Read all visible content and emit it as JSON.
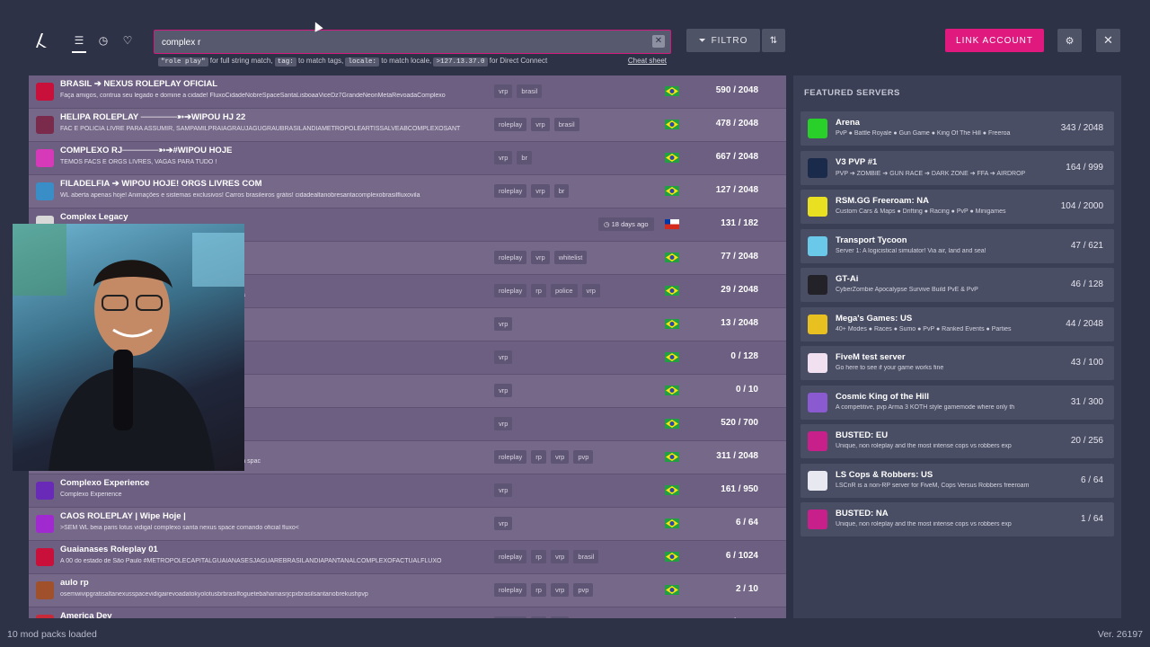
{
  "nav": {
    "logo_icon": "fivem-logo-icon",
    "icons": [
      "list-icon",
      "history-icon",
      "heart-icon"
    ]
  },
  "search": {
    "value": "complex r",
    "hints": {
      "code1": "\"role play\"",
      "text1": " for full string match, ",
      "code2": "tag:",
      "text2": " to match tags, ",
      "code3": "locale:",
      "text3": " to match locale, ",
      "code4": ">127.13.37.0",
      "text4": " for Direct Connect",
      "cheat": "Cheat sheet"
    }
  },
  "toolbar": {
    "filter_label": "FILTRO",
    "link_label": "LINK ACCOUNT"
  },
  "colors": {
    "accent": "#e0197f",
    "list_bg": "#6c5f81",
    "panel_bg": "#3b3f55"
  },
  "servers": [
    {
      "name": "BRASIL ➔ NEXUS ROLEPLAY OFICIAL",
      "desc": "Faça amigos, contrua seu legado e domine a cidade! FluxoCidadeNobreSpaceSantaLisboaaViceDz7GrandeNeonMetaRevoadaComplexo",
      "tags": [
        "vrp",
        "brasil"
      ],
      "updated": "",
      "flag": "brazil",
      "players": "590 / 2048",
      "icon_color": "#c8103a"
    },
    {
      "name": "HELIPA ROLEPLAY ──────➳➔WIPOU HJ 22",
      "desc": "FAC E POLICIA LIVRE PARA ASSUMIR, SAMPAMILPRAIAGRAUJAGUGRAUBRASILANDIAMETROPOLEARTISSALVEABCOMPLEXOSANT",
      "tags": [
        "roleplay",
        "vrp",
        "brasil"
      ],
      "updated": "",
      "flag": "brazil",
      "players": "478 / 2048",
      "icon_color": "#7a2a4a"
    },
    {
      "name": "COMPLEXO RJ──────➳➔#WIPOU HOJE",
      "desc": "TEMOS FACS E ORGS LIVRES, VAGAS PARA TUDO !",
      "tags": [
        "vrp",
        "br"
      ],
      "updated": "",
      "flag": "brazil",
      "players": "667 / 2048",
      "icon_color": "#d63ab8"
    },
    {
      "name": "FILADELFIA ➔ WIPOU HOJE! ORGS LIVRES COM",
      "desc": "WL aberta apenas hoje! Animações e sistemas exclusivos! Carros brasileiros grátis! cidadealtanobresantacomplexobrasilfluxovila",
      "tags": [
        "roleplay",
        "vrp",
        "br"
      ],
      "updated": "",
      "flag": "brazil",
      "players": "127 / 2048",
      "icon_color": "#3a8ec8"
    },
    {
      "name": "Complex Legacy",
      "desc": "",
      "tags": [],
      "updated": "18 days ago",
      "flag": "chile",
      "players": "131 / 182",
      "icon_color": "#d8d8d8"
    },
    {
      "name": "",
      "desc": "celisboadz7brasilneoncomplexocpxmetaeuforiagoatkeerp",
      "tags": [
        "roleplay",
        "vrp",
        "whitelist"
      ],
      "updated": "",
      "flag": "brazil",
      "players": "77 / 2048",
      "icon_color": "#8a6aa0"
    },
    {
      "name": "",
      "desc": "zeszonanortezonalestecomplexobrasilcapitalfluxometropolesampa",
      "tags": [
        "roleplay",
        "rp",
        "police",
        "vrp"
      ],
      "updated": "",
      "flag": "brazil",
      "players": "29 / 2048",
      "icon_color": "#8a6aa0"
    },
    {
      "name": "",
      "desc": "COMPLEXOMETROPOLEALTACIDADEBRASILANDIA",
      "tags": [
        "vrp"
      ],
      "updated": "",
      "flag": "brazil",
      "players": "13 / 2048",
      "icon_color": "#8a6aa0"
    },
    {
      "name": "────",
      "desc": "pace comando oficial fluxo<",
      "tags": [
        "vrp"
      ],
      "updated": "",
      "flag": "brazil",
      "players": "0 / 128",
      "icon_color": "#8a6aa0"
    },
    {
      "name": "────",
      "desc": "pace comando oficial fluxo<",
      "tags": [
        "vrp"
      ],
      "updated": "",
      "flag": "brazil",
      "players": "0 / 10",
      "icon_color": "#8a6aa0"
    },
    {
      "name": "",
      "desc": "",
      "tags": [
        "vrp"
      ],
      "updated": "",
      "flag": "brazil",
      "players": "520 / 700",
      "icon_color": "#8a6aa0"
    },
    {
      "name": "",
      "desc": "hush season rp roleplay city europacity inaugurou Hoje cidade alta spac",
      "tags": [
        "roleplay",
        "rp",
        "vrp",
        "pvp"
      ],
      "updated": "",
      "flag": "brazil",
      "players": "311 / 2048",
      "icon_color": "#8a6aa0"
    },
    {
      "name": "Complexo Experience",
      "desc": "Complexo Experience",
      "tags": [
        "vrp"
      ],
      "updated": "",
      "flag": "brazil",
      "players": "161 / 950",
      "icon_color": "#6a2ab8"
    },
    {
      "name": "CAOS ROLEPLAY | Wipe Hoje |",
      "desc": ">SEM WL beia paris lotus vidigal complexo santa nexus space comando oficial fluxo<",
      "tags": [
        "vrp"
      ],
      "updated": "",
      "flag": "brazil",
      "players": "6 / 64",
      "icon_color": "#a02ad0"
    },
    {
      "name": "Guaianases Roleplay 01",
      "desc": "A 00 do estado de São Paulo #METROPOLECAPITALGUAIANASESJAGUAREBRASILANDIAPANTANALCOMPLEXOFACTUALFLUXO",
      "tags": [
        "roleplay",
        "rp",
        "vrp",
        "brasil"
      ],
      "updated": "",
      "flag": "brazil",
      "players": "6 / 1024",
      "icon_color": "#c8103a"
    },
    {
      "name": "aulo rp",
      "desc": "osemwivipgratisaltanexusspacevidigairevoadatokyolotusbrbrasilfoguetebahamasrjcpxbrasilsantanobrekushpvp",
      "tags": [
        "roleplay",
        "rp",
        "vrp",
        "pvp"
      ],
      "updated": "",
      "flag": "brazil",
      "players": "2 / 10",
      "icon_color": "#a0502a"
    },
    {
      "name": "America Dev",
      "desc": "America roleplay europa season4 amrica americacity vice hush season rp roleplay city europacity inaugurou Hoje cidade alta spac",
      "tags": [
        "roleplay",
        "rp",
        "vrp"
      ],
      "updated": "",
      "flag": "brazil",
      "players": "2 / 2048",
      "icon_color": "#c82a3a"
    }
  ],
  "featured": {
    "title": "FEATURED SERVERS",
    "items": [
      {
        "name": "Arena",
        "desc": "PvP ● Battle Royale ● Gun Game ● King Of The Hill ● Freeroa",
        "players": "343 / 2048",
        "icon_color": "#2ad02a"
      },
      {
        "name": "V3 PVP #1",
        "desc": "PVP ➔ ZOMBIE ➔ GUN RACE ➔ DARK ZONE ➔ FFA ➔ AIRDROP",
        "players": "164 / 999",
        "icon_color": "#1a2a4a"
      },
      {
        "name": "RSM.GG Freeroam: NA",
        "desc": "Custom Cars & Maps ● Drifting ● Racing ● PvP ● Minigames",
        "players": "104 / 2000",
        "icon_color": "#e8e020"
      },
      {
        "name": "Transport Tycoon",
        "desc": "Server 1: A logicistical simulator! Via air, land and sea!",
        "players": "47 / 621",
        "icon_color": "#6ac8e8"
      },
      {
        "name": "GT-Ai",
        "desc": "CyberZombie Apocalypse Survive Build PvE & PvP",
        "players": "46 / 128",
        "icon_color": "#222228"
      },
      {
        "name": "Mega's Games: US",
        "desc": "40+ Modes ● Races ● Sumo ● PvP ● Ranked Events ● Parties",
        "players": "44 / 2048",
        "icon_color": "#e8c020"
      },
      {
        "name": "FiveM test server",
        "desc": "Go here to see if your game works fine",
        "players": "43 / 100",
        "icon_color": "#f0e0f0"
      },
      {
        "name": "Cosmic King of the Hill",
        "desc": "A competitive, pvp Arma 3 KOTH style gamemode where only th",
        "players": "31 / 300",
        "icon_color": "#8a5ad0"
      },
      {
        "name": "BUSTED: EU",
        "desc": "Unique, non roleplay and the most intense cops vs robbers exp",
        "players": "20 / 256",
        "icon_color": "#c8208a"
      },
      {
        "name": "LS Cops & Robbers: US",
        "desc": "LSCnR is a non-RP server for FiveM, Cops Versus Robbers freeroam",
        "players": "6 / 64",
        "icon_color": "#e8e8f0"
      },
      {
        "name": "BUSTED: NA",
        "desc": "Unique, non roleplay and the most intense cops vs robbers exp",
        "players": "1 / 64",
        "icon_color": "#c8208a"
      }
    ]
  },
  "status": {
    "left": "10 mod packs loaded",
    "right": "Ver. 26197"
  }
}
